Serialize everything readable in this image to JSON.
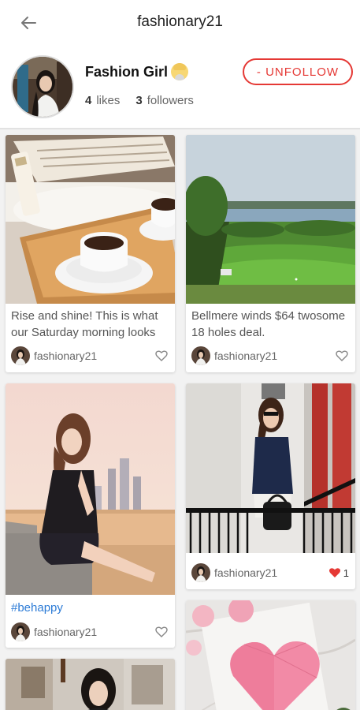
{
  "topbar": {
    "title": "fashionary21"
  },
  "profile": {
    "name": "Fashion Girl",
    "likes_count": "4",
    "likes_label": "likes",
    "followers_count": "3",
    "followers_label": "followers",
    "unfollow_label": "- UNFOLLOW"
  },
  "posts": [
    {
      "caption": "Rise and shine! This is what our Saturday morning looks",
      "author": "fashionary21",
      "likes": ""
    },
    {
      "caption": "Bellmere winds $64 twosome 18 holes deal.",
      "author": "fashionary21",
      "likes": ""
    },
    {
      "caption": "#behappy",
      "author": "fashionary21",
      "likes": ""
    },
    {
      "caption": "",
      "author": "fashionary21",
      "likes": "1"
    }
  ],
  "colors": {
    "accent": "#e53935",
    "hashtag": "#2c7bd6"
  }
}
